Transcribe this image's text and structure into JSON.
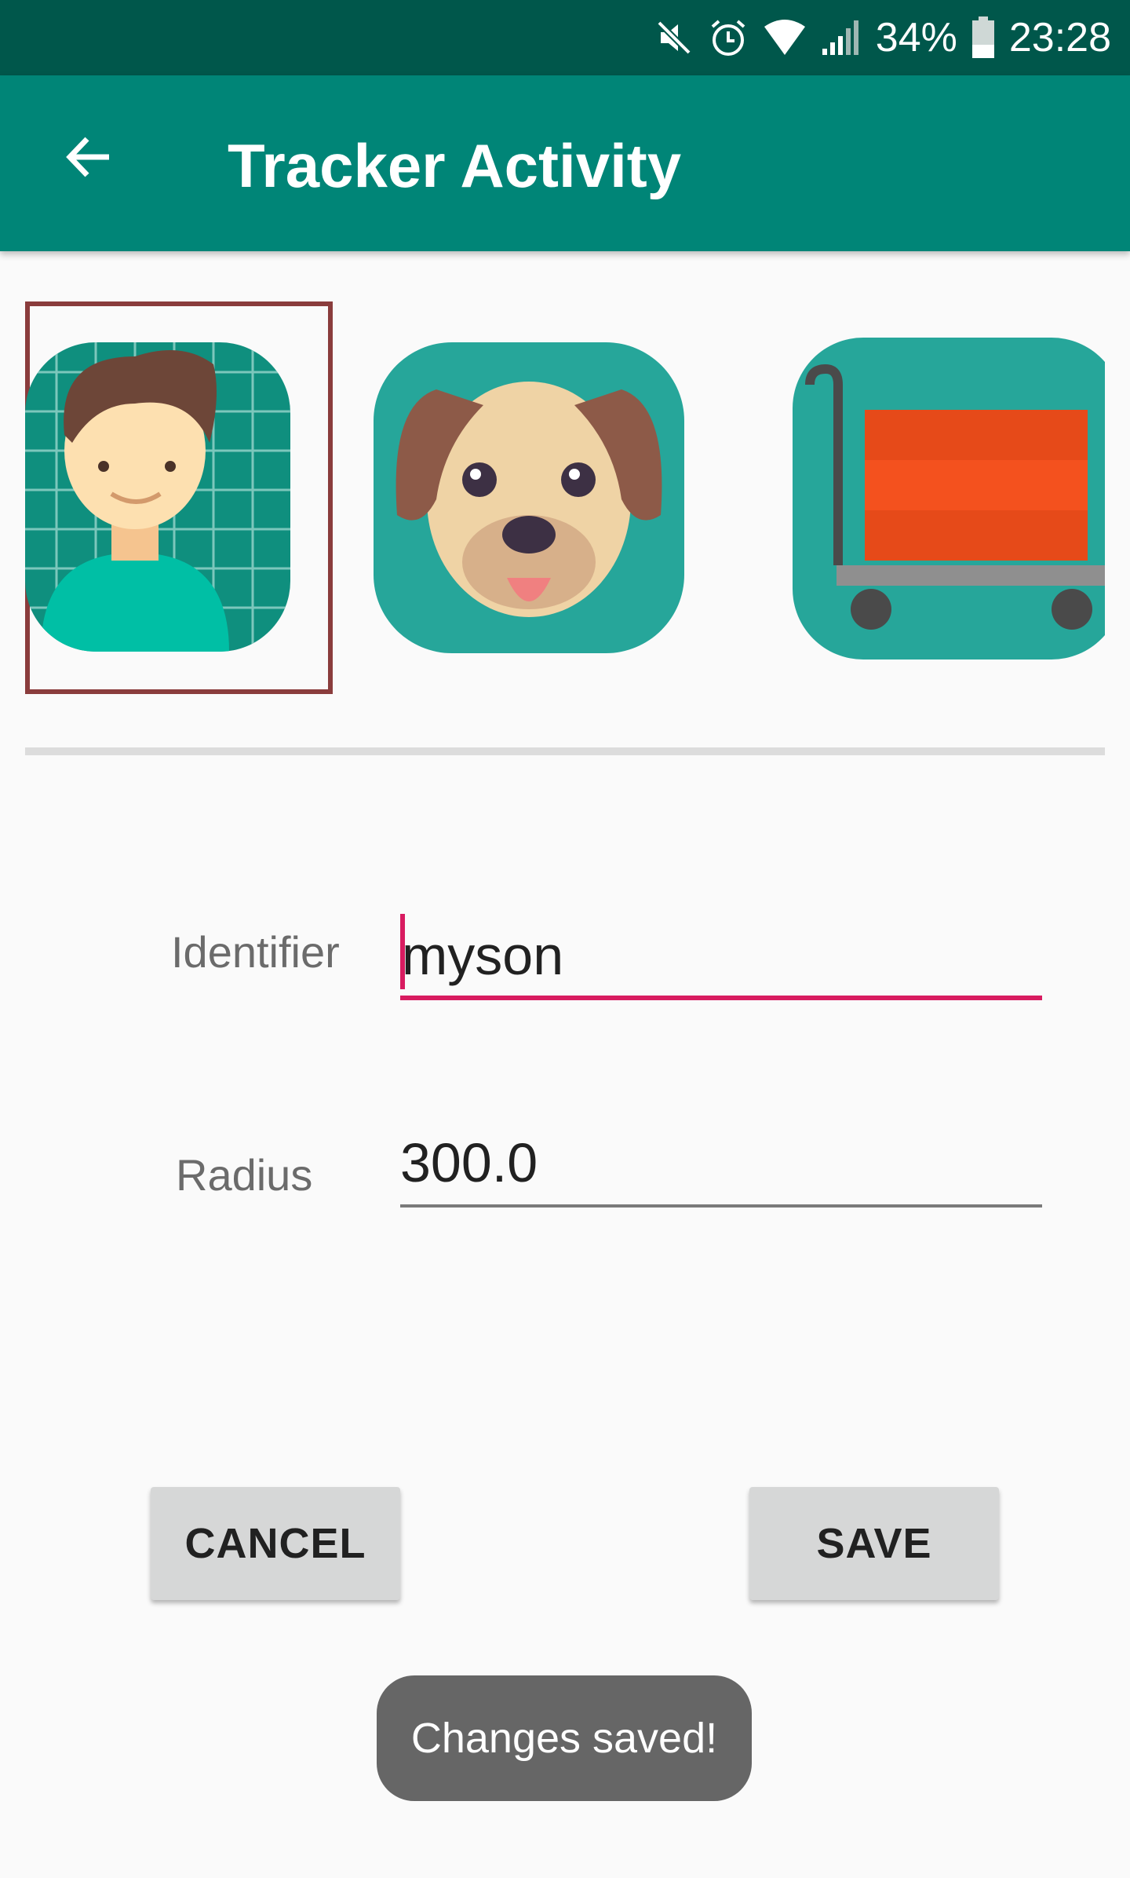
{
  "status_bar": {
    "battery_percent": "34%",
    "time": "23:28",
    "icons": [
      "mute-icon",
      "alarm-icon",
      "wifi-icon",
      "signal-icon",
      "battery-icon"
    ]
  },
  "app_bar": {
    "title": "Tracker Activity",
    "back_icon": "arrow-back-icon"
  },
  "avatars": {
    "items": [
      {
        "name": "boy-avatar",
        "selected": true
      },
      {
        "name": "dog-avatar",
        "selected": false
      },
      {
        "name": "cart-avatar",
        "selected": false
      }
    ]
  },
  "form": {
    "identifier_label": "Identifier",
    "identifier_value": "myson",
    "radius_label": "Radius",
    "radius_value": "300.0"
  },
  "buttons": {
    "cancel_label": "CANCEL",
    "save_label": "SAVE"
  },
  "toast": {
    "message": "Changes saved!"
  },
  "colors": {
    "status_bar": "#00574b",
    "app_bar": "#008577",
    "accent": "#d81b60",
    "selection_border": "#8a3c3c"
  }
}
